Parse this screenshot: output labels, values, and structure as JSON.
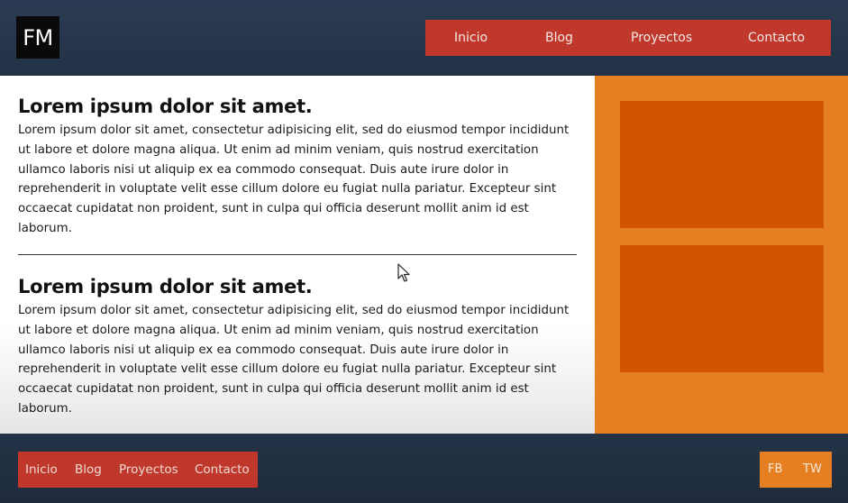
{
  "header": {
    "logo_text": "FM",
    "nav": [
      "Inicio",
      "Blog",
      "Proyectos",
      "Contacto"
    ]
  },
  "main": {
    "articles": [
      {
        "title": "Lorem ipsum dolor sit amet.",
        "body": "Lorem ipsum dolor sit amet, consectetur adipisicing elit, sed do eiusmod tempor incididunt ut labore et dolore magna aliqua. Ut enim ad minim veniam, quis nostrud exercitation ullamco laboris nisi ut aliquip ex ea commodo consequat. Duis aute irure dolor in reprehenderit in voluptate velit esse cillum dolore eu fugiat nulla pariatur. Excepteur sint occaecat cupidatat non proident, sunt in culpa qui officia deserunt mollit anim id est laborum."
      },
      {
        "title": "Lorem ipsum dolor sit amet.",
        "body": "Lorem ipsum dolor sit amet, consectetur adipisicing elit, sed do eiusmod tempor incididunt ut labore et dolore magna aliqua. Ut enim ad minim veniam, quis nostrud exercitation ullamco laboris nisi ut aliquip ex ea commodo consequat. Duis aute irure dolor in reprehenderit in voluptate velit esse cillum dolore eu fugiat nulla pariatur. Excepteur sint occaecat cupidatat non proident, sunt in culpa qui officia deserunt mollit anim id est laborum."
      }
    ]
  },
  "footer": {
    "nav": [
      "Inicio",
      "Blog",
      "Proyectos",
      "Contacto"
    ],
    "social": [
      "FB",
      "TW"
    ]
  },
  "colors": {
    "background": "#243347",
    "nav_red": "#c0382b",
    "sidebar_orange": "#e67e22",
    "box_orange": "#d35400"
  },
  "icons": {
    "cursor": "mouse-pointer-icon"
  }
}
